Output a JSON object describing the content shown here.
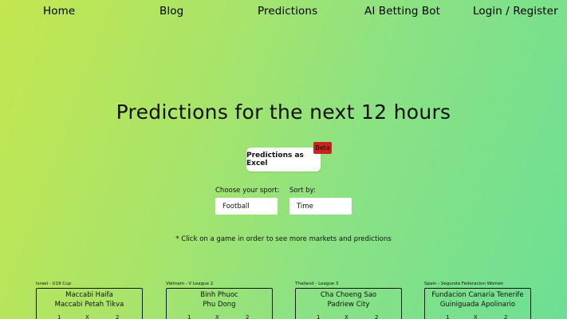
{
  "nav": {
    "home": "Home",
    "blog": "Blog",
    "predictions": "Predictions",
    "ai_bot": "AI Betting Bot",
    "login": "Login / Register"
  },
  "headline": "Predictions for the next 12 hours",
  "excel_button": {
    "label": "Predictions as Excel",
    "badge": "Beta"
  },
  "controls": {
    "sport_label": "Choose your sport:",
    "sport_value": "Football",
    "sort_label": "Sort by:",
    "sort_value": "Time"
  },
  "hint": "* Click on a game in order to see more markets and predictions",
  "games": [
    {
      "league": "Israel - U19 Cup",
      "home": "Maccabi Haifa",
      "away": "Maccabi Petah Tikva",
      "o1": "1",
      "ox": "X",
      "o2": "2"
    },
    {
      "league": "Vietnam - V League 2",
      "home": "Binh Phuoc",
      "away": "Phu Dong",
      "o1": "1",
      "ox": "X",
      "o2": "2"
    },
    {
      "league": "Thailand - League 3",
      "home": "Cha Choeng Sao",
      "away": "Padriew City",
      "o1": "1",
      "ox": "X",
      "o2": "2"
    },
    {
      "league": "Spain - Segunda Federacion Women",
      "home": "Fundacion Canaria Tenerife",
      "away": "Guiniguada Apolinario",
      "o1": "1",
      "ox": "X",
      "o2": "2"
    }
  ]
}
